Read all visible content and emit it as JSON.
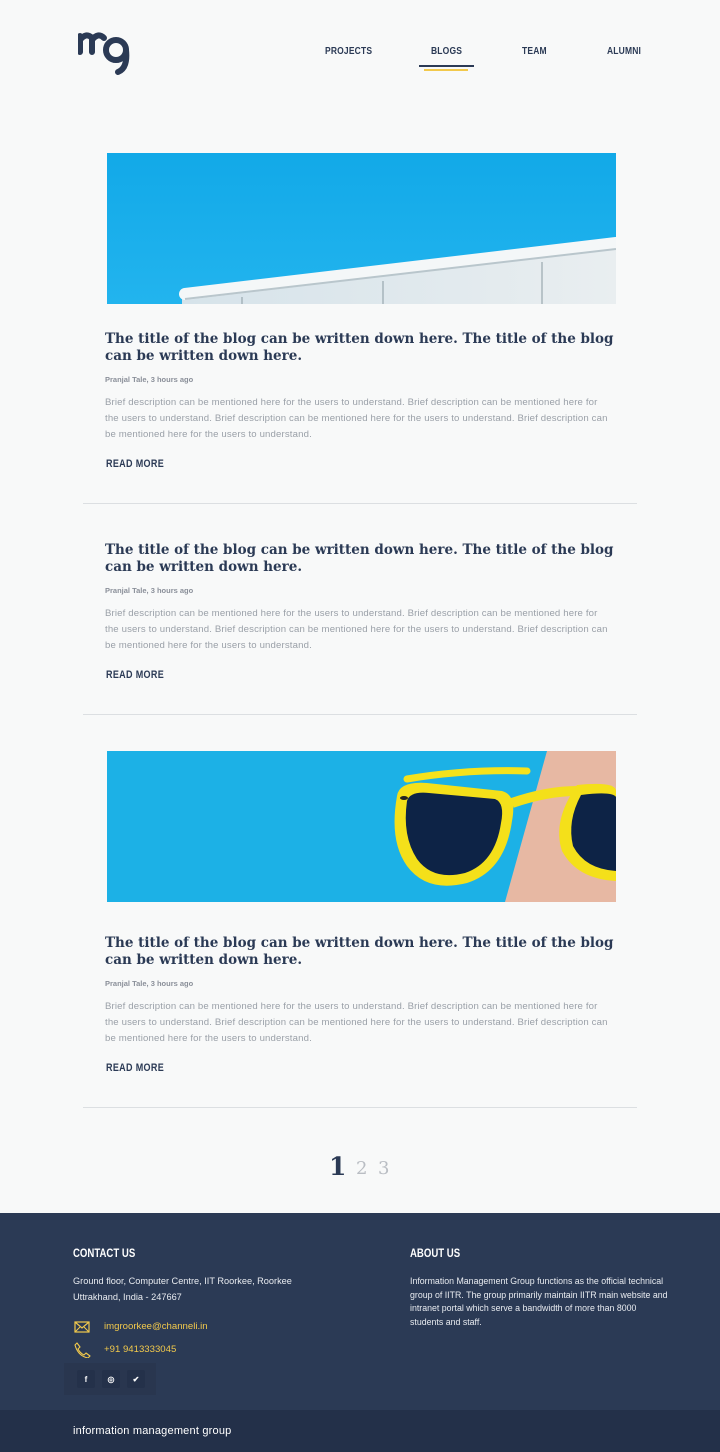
{
  "brand": {
    "logo_icon": "img-logo-icon",
    "accent": "#f2c94c",
    "primary": "#2b3a55"
  },
  "nav": {
    "items": [
      {
        "label": "PROJECTS"
      },
      {
        "label": "BLOGS",
        "active": true
      },
      {
        "label": "TEAM"
      },
      {
        "label": "ALUMNI"
      }
    ]
  },
  "posts": [
    {
      "has_image": true,
      "image": "railing-sky-photo",
      "title": "The title of the blog can be written down here. The title of the blog can be written down here.",
      "meta": "Pranjal Tale, 3 hours ago",
      "description": "Brief description can be mentioned here for the users to understand. Brief description can be mentioned here for the users to understand. Brief description can be mentioned here for the users to understand. Brief description can be mentioned here for the users to understand.",
      "read_more": "READ  MORE"
    },
    {
      "has_image": false,
      "title": "The title of the blog can be written down here. The title of the blog can be written down here.",
      "meta": "Pranjal Tale, 3 hours ago",
      "description": "Brief description can be mentioned here for the users to understand. Brief description can be mentioned here for the users to understand. Brief description can be mentioned here for the users to understand. Brief description can be mentioned here for the users to understand.",
      "read_more": "READ  MORE"
    },
    {
      "has_image": true,
      "image": "sunglasses-photo",
      "title": "The title of the blog can be written down here. The title of the blog can be written down here.",
      "meta": "Pranjal Tale, 3 hours ago",
      "description": "Brief description can be mentioned here for the users to understand. Brief description can be mentioned here for the users to understand. Brief description can be mentioned here for the users to understand. Brief description can be mentioned here for the users to understand.",
      "read_more": "READ  MORE"
    }
  ],
  "pagination": {
    "pages": [
      "1",
      "2",
      "3"
    ],
    "current": "1"
  },
  "footer": {
    "contact_heading": "CONTACT US",
    "address_line1": "Ground floor, Computer Centre, IIT Roorkee, Roorkee",
    "address_line2": "Uttrakhand, India - 247667",
    "email_icon": "mail-icon",
    "email": "imgroorkee@channeli.in",
    "phone_icon": "phone-icon",
    "phone": "+91 9413333045",
    "social": [
      {
        "name": "facebook-icon",
        "glyph": "f"
      },
      {
        "name": "github-icon",
        "glyph": "◎"
      },
      {
        "name": "twitter-icon",
        "glyph": "✔"
      }
    ],
    "about_heading": "ABOUT US",
    "about_text": "Information Management Group functions as the official technical group of IITR. The group primarily maintain IITR main website and intranet portal which serve a bandwidth of more than 8000 students and staff.",
    "bottom_label": "information management group"
  }
}
